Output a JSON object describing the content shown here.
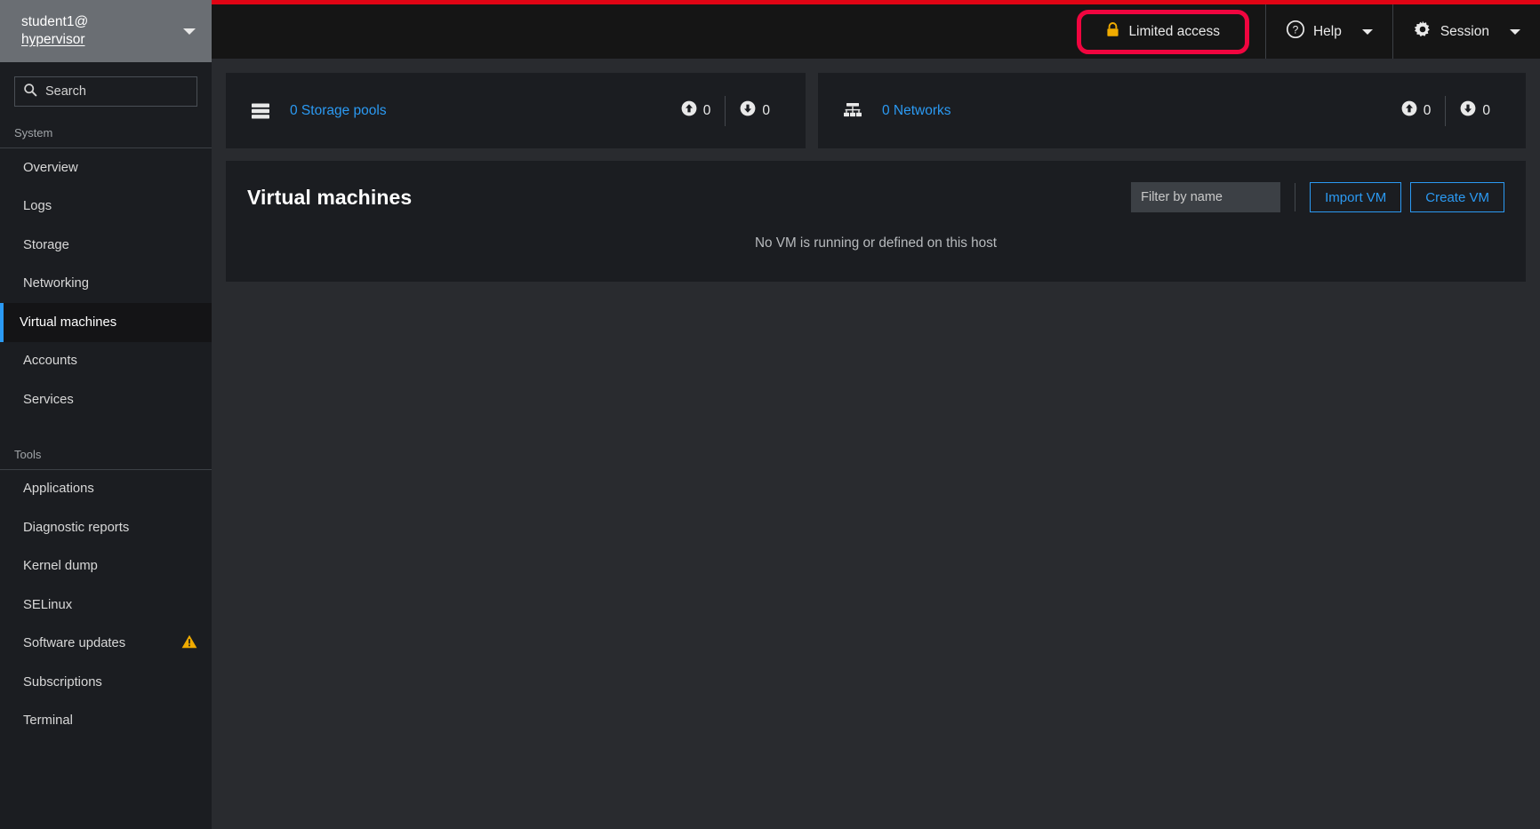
{
  "colors": {
    "accent_blue": "#2b9af3",
    "brand_red": "#e00414",
    "highlight_red": "#f0053f",
    "warning_amber": "#f0ab00",
    "lock_gold": "#f0ab00",
    "sidebar_bg": "#1b1d21",
    "main_bg": "#292b2f",
    "topbar_bg": "#151515",
    "host_switch_bg": "#6a6e73"
  },
  "sidebar": {
    "host": {
      "user": "student1@",
      "hostname": "hypervisor",
      "caret_icon": "chevron-down-icon"
    },
    "search": {
      "placeholder": "Search",
      "value": "",
      "icon": "search-icon"
    },
    "groups": [
      {
        "title": "System",
        "items": [
          {
            "label": "Overview",
            "active": false,
            "badge": ""
          },
          {
            "label": "Logs",
            "active": false,
            "badge": ""
          },
          {
            "label": "Storage",
            "active": false,
            "badge": ""
          },
          {
            "label": "Networking",
            "active": false,
            "badge": ""
          },
          {
            "label": "Virtual machines",
            "active": true,
            "badge": ""
          },
          {
            "label": "Accounts",
            "active": false,
            "badge": ""
          },
          {
            "label": "Services",
            "active": false,
            "badge": ""
          }
        ]
      },
      {
        "title": "Tools",
        "items": [
          {
            "label": "Applications",
            "active": false,
            "badge": ""
          },
          {
            "label": "Diagnostic reports",
            "active": false,
            "badge": ""
          },
          {
            "label": "Kernel dump",
            "active": false,
            "badge": ""
          },
          {
            "label": "SELinux",
            "active": false,
            "badge": ""
          },
          {
            "label": "Software updates",
            "active": false,
            "badge": "warning-triangle-icon"
          },
          {
            "label": "Subscriptions",
            "active": false,
            "badge": ""
          },
          {
            "label": "Terminal",
            "active": false,
            "badge": ""
          }
        ]
      }
    ]
  },
  "topbar": {
    "limited_access": {
      "label": "Limited access",
      "icon": "lock-icon",
      "highlighted": true
    },
    "help": {
      "label": "Help",
      "icon": "help-circle-icon",
      "caret_icon": "chevron-down-icon"
    },
    "session": {
      "label": "Session",
      "icon": "gear-icon",
      "caret_icon": "chevron-down-icon"
    }
  },
  "cards": {
    "storage_pools": {
      "link_label": "0 Storage pools",
      "icon": "storage-pool-icon",
      "up_value": "0",
      "down_value": "0",
      "up_icon": "arrow-up-circle-icon",
      "down_icon": "arrow-down-circle-icon"
    },
    "networks": {
      "link_label": "0 Networks",
      "icon": "network-icon",
      "up_value": "0",
      "down_value": "0",
      "up_icon": "arrow-up-circle-icon",
      "down_icon": "arrow-down-circle-icon"
    }
  },
  "vm_panel": {
    "title": "Virtual machines",
    "filter": {
      "placeholder": "Filter by name",
      "value": ""
    },
    "import_button": "Import VM",
    "create_button": "Create VM",
    "empty_message": "No VM is running or defined on this host"
  }
}
